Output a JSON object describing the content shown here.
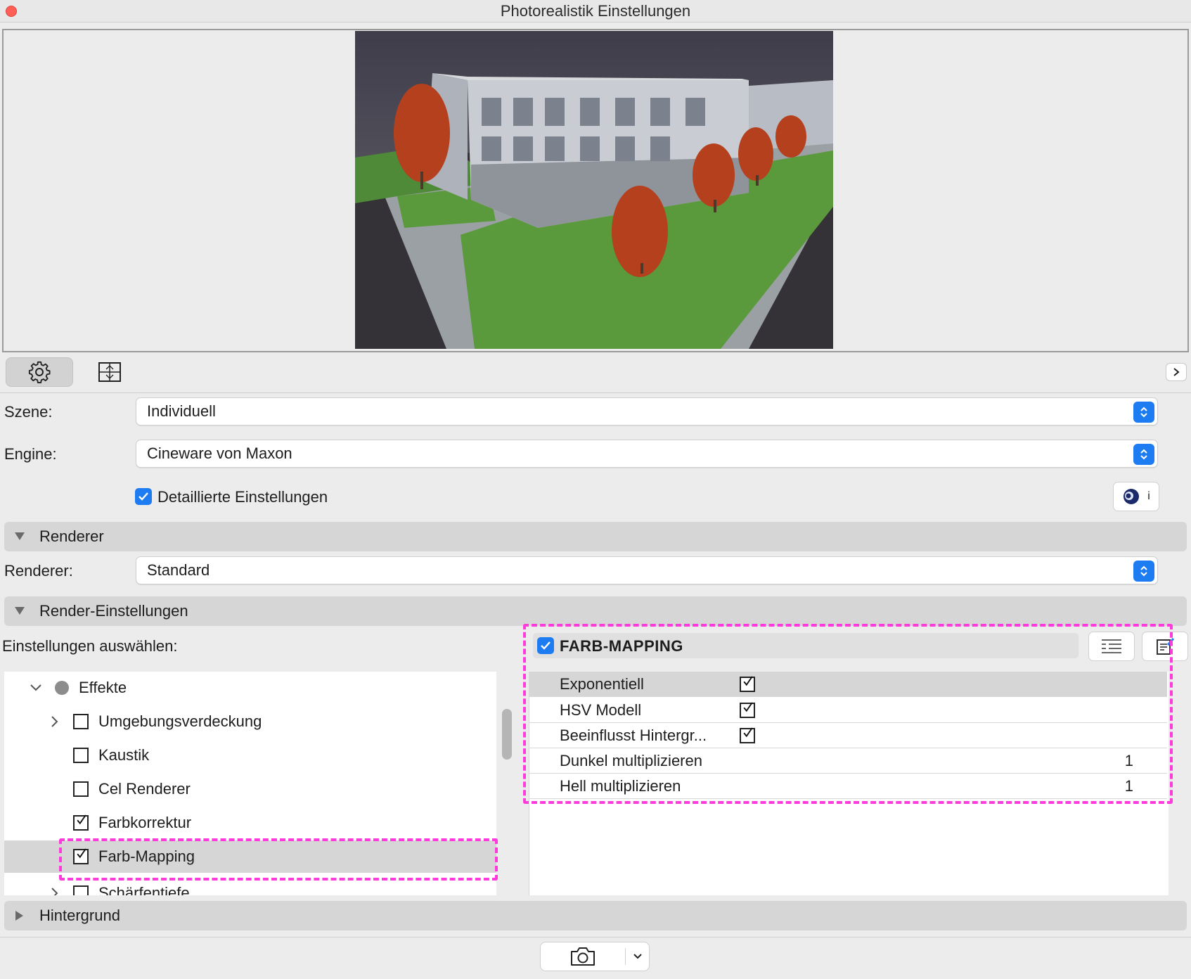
{
  "window": {
    "title": "Photorealistik Einstellungen"
  },
  "toolbar": {
    "settings_icon": "gear-icon",
    "crop_icon": "crop-frame-icon",
    "expand_icon": "chevron-right-icon"
  },
  "scene": {
    "label": "Szene:",
    "value": "Individuell"
  },
  "engine": {
    "label": "Engine:",
    "value": "Cineware von Maxon"
  },
  "detailed": {
    "label": "Detaillierte Einstellungen",
    "checked": true,
    "info_label": "i"
  },
  "renderer_section": {
    "title": "Renderer"
  },
  "renderer": {
    "label": "Renderer:",
    "value": "Standard"
  },
  "render_settings_section": {
    "title": "Render-Einstellungen"
  },
  "select_settings": {
    "label": "Einstellungen auswählen:"
  },
  "tree": {
    "group": "Effekte",
    "items": [
      {
        "label": "Umgebungsverdeckung",
        "checked": false,
        "expandable": true
      },
      {
        "label": "Kaustik",
        "checked": false,
        "expandable": false
      },
      {
        "label": "Cel Renderer",
        "checked": false,
        "expandable": false
      },
      {
        "label": "Farbkorrektur",
        "checked": true,
        "expandable": false
      },
      {
        "label": "Farb-Mapping",
        "checked": true,
        "expandable": false,
        "selected": true
      },
      {
        "label": "Schärfentiefe",
        "checked": false,
        "expandable": true
      }
    ]
  },
  "farb_mapping": {
    "title": "FARB-MAPPING",
    "enabled": true,
    "properties": [
      {
        "name": "Exponentiell",
        "checked": true
      },
      {
        "name": "HSV Modell",
        "checked": true
      },
      {
        "name": "Beeinflusst Hintergr...",
        "checked": true
      },
      {
        "name": "Dunkel multiplizieren",
        "value": "1"
      },
      {
        "name": "Hell multiplizieren",
        "value": "1"
      }
    ]
  },
  "background_section": {
    "title": "Hintergrund"
  },
  "colors": {
    "accent": "#1e7cf2",
    "highlight": "#ff3bdc",
    "close": "#ff5f57"
  }
}
